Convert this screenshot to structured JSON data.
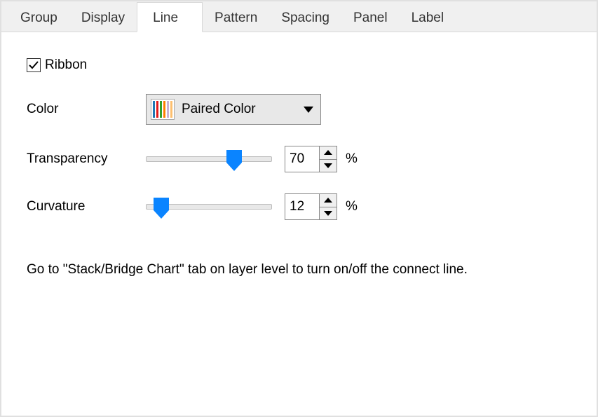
{
  "tabs": {
    "items": [
      {
        "label": "Group"
      },
      {
        "label": "Display"
      },
      {
        "label": "Line"
      },
      {
        "label": "Pattern"
      },
      {
        "label": "Spacing"
      },
      {
        "label": "Panel"
      },
      {
        "label": "Label"
      }
    ],
    "active_index": 2
  },
  "ribbon": {
    "label": "Ribbon",
    "checked": true
  },
  "color": {
    "label": "Color",
    "selected": "Paired Color",
    "swatch_colors": [
      "#1f78b4",
      "#e31a1c",
      "#33a02c",
      "#ff7f00",
      "#cab2d6",
      "#fdbf6f"
    ]
  },
  "transparency": {
    "label": "Transparency",
    "value": "70",
    "unit": "%",
    "slider_percent": 70
  },
  "curvature": {
    "label": "Curvature",
    "value": "12",
    "unit": "%",
    "slider_percent": 12
  },
  "help_text": "Go to \"Stack/Bridge Chart\" tab on layer level to turn on/off the connect line."
}
